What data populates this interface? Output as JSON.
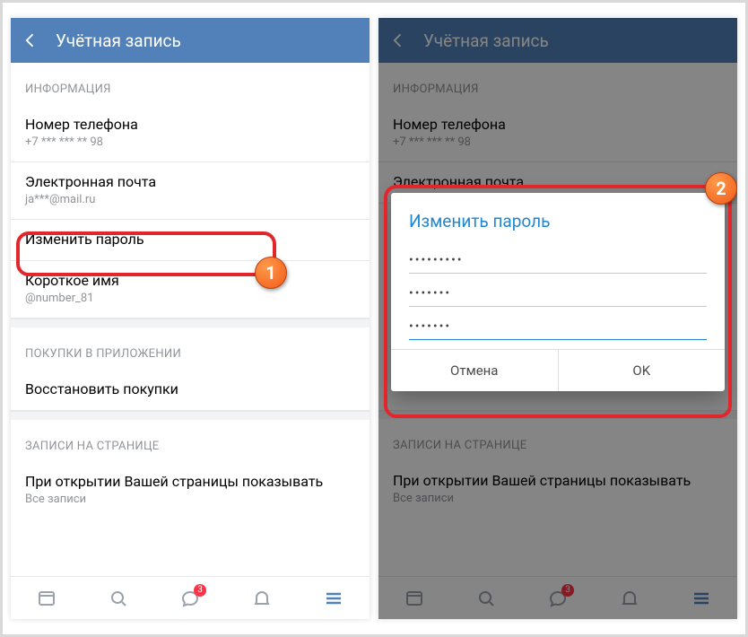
{
  "header": {
    "title": "Учётная запись"
  },
  "sections": {
    "info_label": "ИНФОРМАЦИЯ",
    "phone_title": "Номер телефона",
    "phone_value": "+7 *** *** ** 98",
    "email_title": "Электронная почта",
    "email_value": "ja***@mail.ru",
    "password_title": "Изменить пароль",
    "shortname_title": "Короткое имя",
    "shortname_value": "@number_81",
    "purchases_label": "ПОКУПКИ В ПРИЛОЖЕНИИ",
    "restore_purchases": "Восстановить покупки",
    "wall_label": "ЗАПИСИ НА СТРАНИЦЕ",
    "wall_option_title": "При открытии Вашей страницы показывать",
    "wall_option_value": "Все записи"
  },
  "nav": {
    "messages_badge": "3"
  },
  "dialog": {
    "title": "Изменить пароль",
    "pw1": "•••••••••",
    "pw2": "•••••••",
    "pw3": "•••••••",
    "cancel": "Отмена",
    "ok": "OK"
  },
  "callouts": {
    "one": "1",
    "two": "2"
  },
  "colors": {
    "accent": "#5181B8"
  }
}
